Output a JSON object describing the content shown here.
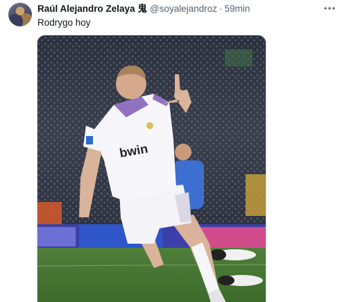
{
  "author": {
    "display_name": "Raúl Alejandro Zelaya",
    "emoji": "鬼",
    "handle": "@soyalejandroz",
    "separator": "·",
    "time": "59min"
  },
  "tweet": {
    "text": "Rodrygo hoy"
  },
  "media": {
    "description_alt": "Photo of a footballer in a white kit celebrating with a raised finger",
    "jersey_sponsor": "bwin"
  },
  "icons": {
    "more": "more-horizontal-icon"
  },
  "colors": {
    "text_primary": "#0f1419",
    "text_secondary": "#536471",
    "border": "#cfd9de"
  }
}
